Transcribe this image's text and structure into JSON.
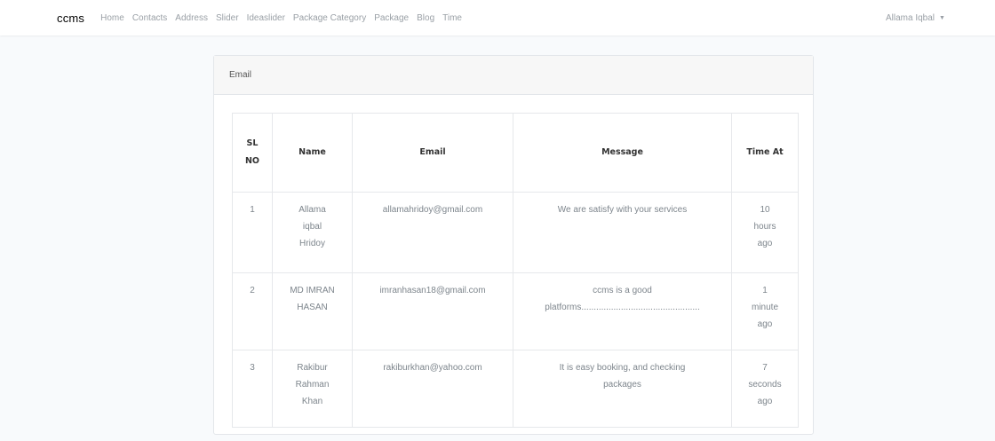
{
  "navbar": {
    "brand": "ccms",
    "links": [
      "Home",
      "Contacts",
      "Address",
      "Slider",
      "Ideaslider",
      "Package Category",
      "Package",
      "Blog",
      "Time"
    ],
    "user": "Allama Iqbal",
    "user_caret_icon": "caret-down-icon"
  },
  "card": {
    "title": "Email",
    "table": {
      "headers": {
        "sl_line1": "SL",
        "sl_line2": "NO",
        "name": "Name",
        "email": "Email",
        "message": "Message",
        "time": "Time At"
      },
      "rows": [
        {
          "sl": "1",
          "name": [
            "Allama",
            "iqbal",
            "Hridoy"
          ],
          "email": "allamahridoy@gmail.com",
          "message": [
            "We are satisfy with your services"
          ],
          "time": [
            "10",
            "hours",
            "ago"
          ]
        },
        {
          "sl": "2",
          "name": [
            "MD IMRAN",
            "HASAN"
          ],
          "email": "imranhasan18@gmail.com",
          "message": [
            "ccms is a good",
            "platforms................................................"
          ],
          "time": [
            "1",
            "minute",
            "ago"
          ]
        },
        {
          "sl": "3",
          "name": [
            "Rakibur",
            "Rahman",
            "Khan"
          ],
          "email": "rakiburkhan@yahoo.com",
          "message": [
            "It is easy booking, and checking",
            "packages"
          ],
          "time": [
            "7",
            "seconds",
            "ago"
          ]
        }
      ]
    }
  }
}
